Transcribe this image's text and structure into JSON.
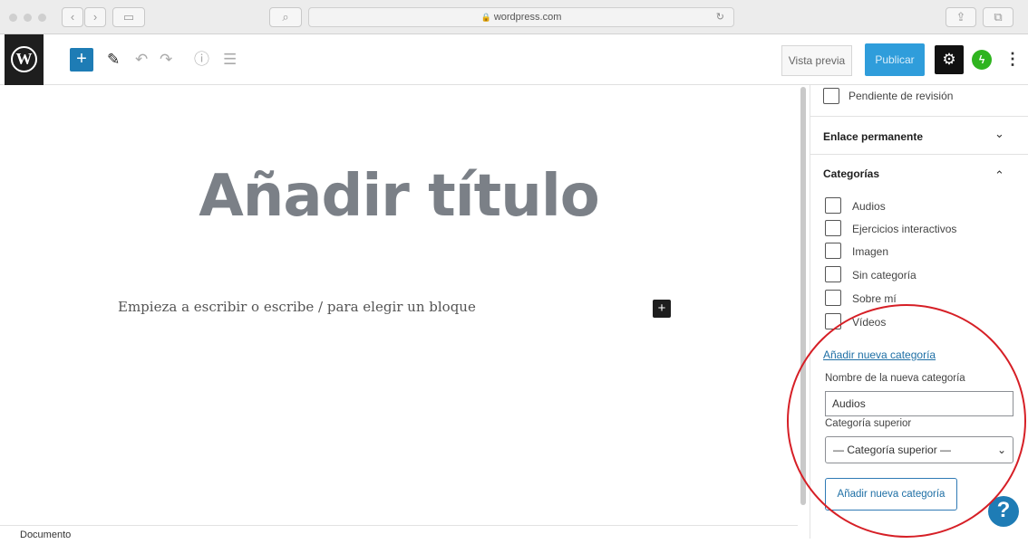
{
  "browser": {
    "url": "wordpress.com",
    "back_icon": "chevron-left-icon",
    "forward_icon": "chevron-right-icon",
    "sidebar_icon": "sidebar-icon",
    "search_icon": "search-icon",
    "reload_icon": "reload-icon",
    "share_icon": "share-icon",
    "tabs_icon": "tabs-icon"
  },
  "toolbar": {
    "logo_letter": "W",
    "add_block_glyph": "+",
    "edit_glyph": "✎",
    "undo_glyph": "↶",
    "redo_glyph": "↷",
    "info_glyph": "ⓘ",
    "outline_glyph": "☰",
    "preview_label": "Vista previa",
    "publish_label": "Publicar",
    "settings_glyph": "⚙",
    "jetpack_glyph": "ϟ",
    "more_glyph": "⋮"
  },
  "editor": {
    "title_placeholder": "Añadir título",
    "block_placeholder": "Empieza a escribir o escribe / para elegir un bloque",
    "inline_add_glyph": "+",
    "footer_label": "Documento"
  },
  "sidebar": {
    "pending_review_label": "Pendiente de revisión",
    "permalink_title": "Enlace permanente",
    "permalink_chevron": "⌄",
    "categories_title": "Categorías",
    "categories_chevron": "⌃",
    "categories": [
      {
        "label": "Audios",
        "checked": false
      },
      {
        "label": "Ejercicios interactivos",
        "checked": false
      },
      {
        "label": "Imagen",
        "checked": false
      },
      {
        "label": "Sin categoría",
        "checked": false
      },
      {
        "label": "Sobre mí",
        "checked": false
      },
      {
        "label": "Vídeos",
        "checked": false
      }
    ],
    "add_new_link": "Añadir nueva categoría",
    "new_name_label": "Nombre de la nueva categoría",
    "new_name_value": "Audios",
    "parent_label": "Categoría superior",
    "parent_select_value": "— Categoría superior —",
    "select_arrow": "⌄",
    "add_button_label": "Añadir nueva categoría"
  },
  "help": {
    "glyph": "?"
  },
  "colors": {
    "accent": "#2f9ddb",
    "highlight_circle": "#d61f26",
    "jetpack": "#2fb41f"
  }
}
